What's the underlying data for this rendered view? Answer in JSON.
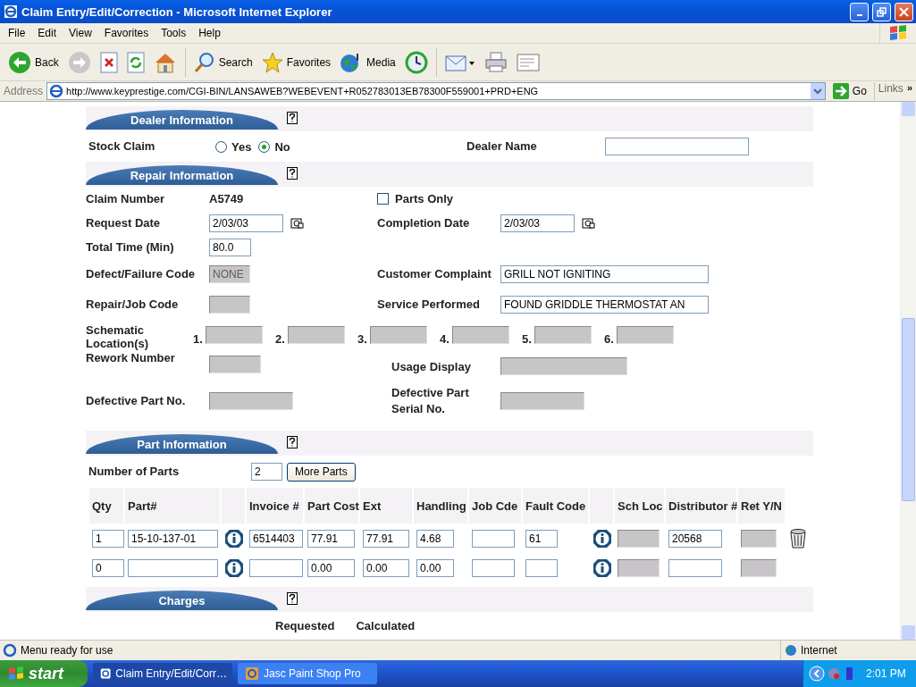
{
  "window": {
    "title": "Claim Entry/Edit/Correction - Microsoft Internet Explorer"
  },
  "menu": [
    "File",
    "Edit",
    "View",
    "Favorites",
    "Tools",
    "Help"
  ],
  "toolbar": [
    {
      "kind": "back",
      "label": "Back"
    },
    {
      "kind": "forward"
    },
    {
      "kind": "stop"
    },
    {
      "kind": "refresh"
    },
    {
      "kind": "home"
    },
    {
      "kind": "search",
      "label": "Search"
    },
    {
      "kind": "favorites",
      "label": "Favorites"
    },
    {
      "kind": "media",
      "label": "Media"
    },
    {
      "kind": "history"
    },
    {
      "kind": "mail"
    },
    {
      "kind": "print"
    },
    {
      "kind": "edit"
    }
  ],
  "address": {
    "label": "Address",
    "url": "http://www.keyprestige.com/CGI-BIN/LANSAWEB?WEBEVENT+R052783013EB78300F559001+PRD+ENG",
    "go": "Go",
    "links": "Links",
    "more": "»"
  },
  "dealer_section": {
    "title": "Dealer Information",
    "stock_claim": {
      "label": "Stock Claim",
      "options": [
        {
          "label": "Yes",
          "selected": false
        },
        {
          "label": "No",
          "selected": true
        }
      ]
    },
    "dealer_name": {
      "label": "Dealer Name"
    }
  },
  "repair_section": {
    "title": "Repair Information",
    "claim_number": {
      "label": "Claim Number",
      "value": "A5749"
    },
    "parts_only": {
      "label": "Parts Only",
      "checked": false
    },
    "request_date": {
      "label": "Request Date",
      "value": "2/03/03"
    },
    "completion_date": {
      "label": "Completion Date",
      "value": "2/03/03"
    },
    "total_time": {
      "label": "Total Time (Min)",
      "value": "80.0"
    },
    "defect_code": {
      "label": "Defect/Failure Code",
      "value": "NONE",
      "disabled": true
    },
    "customer_complaint": {
      "label": "Customer Complaint",
      "value": "GRILL NOT IGNITING"
    },
    "repair_code": {
      "label": "Repair/Job Code",
      "disabled": true
    },
    "service_performed": {
      "label": "Service Performed",
      "value": "FOUND GRIDDLE THERMOSTAT AN"
    },
    "schematic": {
      "label": "Schematic Location(s)",
      "slots": [
        {
          "number": "1.",
          "disabled": true
        },
        {
          "number": "2.",
          "disabled": true
        },
        {
          "number": "3.",
          "disabled": true
        },
        {
          "number": "4.",
          "disabled": true
        },
        {
          "number": "5.",
          "disabled": true
        },
        {
          "number": "6.",
          "disabled": true
        }
      ]
    },
    "rework_number": {
      "label": "Rework Number",
      "disabled": true
    },
    "usage_display": {
      "label": "Usage Display",
      "disabled": true
    },
    "defective_part_no": {
      "label": "Defective Part No.",
      "disabled": true
    },
    "defective_serial": {
      "label": "Defective Part Serial No.",
      "disabled": true
    }
  },
  "part_section": {
    "title": "Part Information",
    "number_of_parts": {
      "label": "Number of Parts",
      "value": "2"
    },
    "more_button": "More Parts",
    "columns": [
      {
        "kind": "text",
        "label": "Qty"
      },
      {
        "kind": "text",
        "label": "Part#"
      },
      {
        "kind": "blank"
      },
      {
        "kind": "text",
        "label": "Invoice #"
      },
      {
        "kind": "text",
        "label": "Part Cost"
      },
      {
        "kind": "text",
        "label": "Ext"
      },
      {
        "kind": "text",
        "label": "Handling"
      },
      {
        "kind": "text",
        "label": "Job Cde"
      },
      {
        "kind": "text",
        "label": "Fault Code"
      },
      {
        "kind": "blank"
      },
      {
        "kind": "text",
        "label": "Sch Loc"
      },
      {
        "kind": "text",
        "label": "Distributor #"
      },
      {
        "kind": "text",
        "label": "Ret Y/N"
      }
    ],
    "rows": [
      {
        "deletable": true,
        "cells": [
          {
            "kind": "field",
            "value": "1"
          },
          {
            "kind": "field",
            "value": "15-10-137-01"
          },
          {
            "kind": "info"
          },
          {
            "kind": "field",
            "value": "6514403"
          },
          {
            "kind": "field",
            "value": "77.91"
          },
          {
            "kind": "field",
            "value": "77.91"
          },
          {
            "kind": "field",
            "value": "4.68"
          },
          {
            "kind": "field"
          },
          {
            "kind": "field",
            "value": "61"
          },
          {
            "kind": "info"
          },
          {
            "kind": "field",
            "disabled": true
          },
          {
            "kind": "field",
            "value": "20568"
          },
          {
            "kind": "field",
            "disabled": true
          }
        ]
      },
      {
        "deletable": false,
        "cells": [
          {
            "kind": "field",
            "value": "0"
          },
          {
            "kind": "field"
          },
          {
            "kind": "info"
          },
          {
            "kind": "field"
          },
          {
            "kind": "field",
            "value": "0.00"
          },
          {
            "kind": "field",
            "value": "0.00"
          },
          {
            "kind": "field",
            "value": "0.00"
          },
          {
            "kind": "field"
          },
          {
            "kind": "field"
          },
          {
            "kind": "info"
          },
          {
            "kind": "field",
            "disabled": true
          },
          {
            "kind": "field"
          },
          {
            "kind": "field",
            "disabled": true
          }
        ]
      }
    ]
  },
  "charges_section": {
    "title": "Charges",
    "columns": [
      "Requested",
      "Calculated"
    ]
  },
  "status_bar": {
    "text": "Menu ready for use",
    "zone": "Internet"
  },
  "taskbar": {
    "start": "start",
    "tasks": [
      {
        "label": "Claim Entry/Edit/Corr…",
        "selected": true
      },
      {
        "label": "Jasc Paint Shop Pro",
        "selected": false
      }
    ],
    "clock": "2:01 PM"
  }
}
